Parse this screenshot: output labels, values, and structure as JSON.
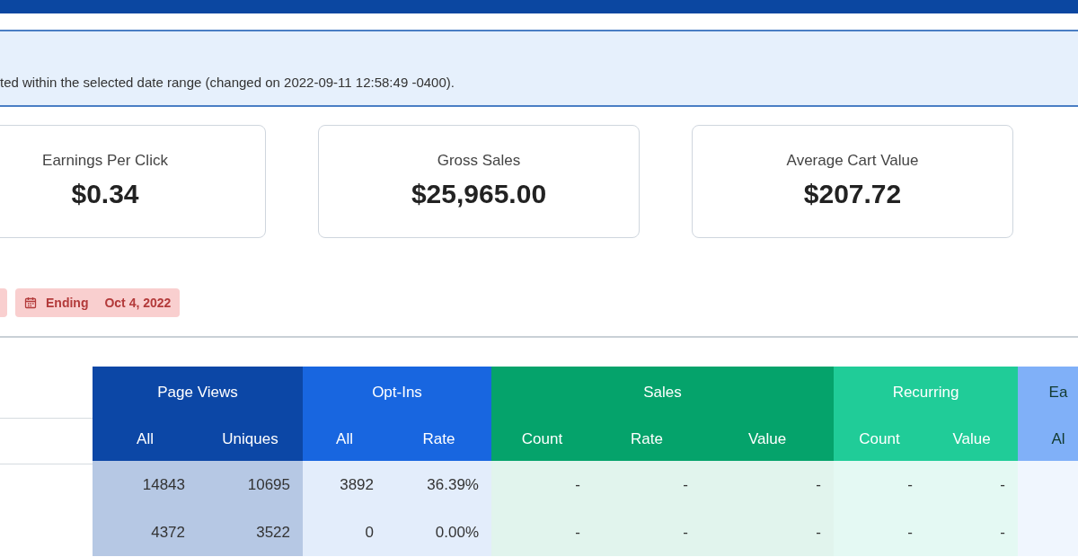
{
  "notice": {
    "text": "ted within the selected date range (changed on 2022-09-11 12:58:49 -0400)."
  },
  "stats": [
    {
      "label": "Earnings Per Click",
      "value": "$0.34"
    },
    {
      "label": "Gross Sales",
      "value": "$25,965.00"
    },
    {
      "label": "Average Cart Value",
      "value": "$207.72"
    }
  ],
  "date_filter": {
    "label": "Ending",
    "value": "Oct 4, 2022"
  },
  "table": {
    "groups": [
      {
        "label": "Page Views",
        "color": "#0c47a6",
        "columns": [
          "All",
          "Uniques"
        ]
      },
      {
        "label": "Opt-Ins",
        "color": "#1866e0",
        "columns": [
          "All",
          "Rate"
        ]
      },
      {
        "label": "Sales",
        "color": "#05a36b",
        "columns": [
          "Count",
          "Rate",
          "Value"
        ]
      },
      {
        "label": "Recurring",
        "color": "#20cc98",
        "columns": [
          "Count",
          "Value"
        ]
      },
      {
        "label": "Ea",
        "color": "#80b0f8",
        "columns": [
          "Al"
        ]
      }
    ],
    "rows": [
      {
        "cells": [
          "14843",
          "10695",
          "3892",
          "36.39%",
          "-",
          "-",
          "-",
          "-",
          "-"
        ]
      },
      {
        "cells": [
          "4372",
          "3522",
          "0",
          "0.00%",
          "-",
          "-",
          "-",
          "-",
          "-"
        ]
      }
    ]
  }
}
